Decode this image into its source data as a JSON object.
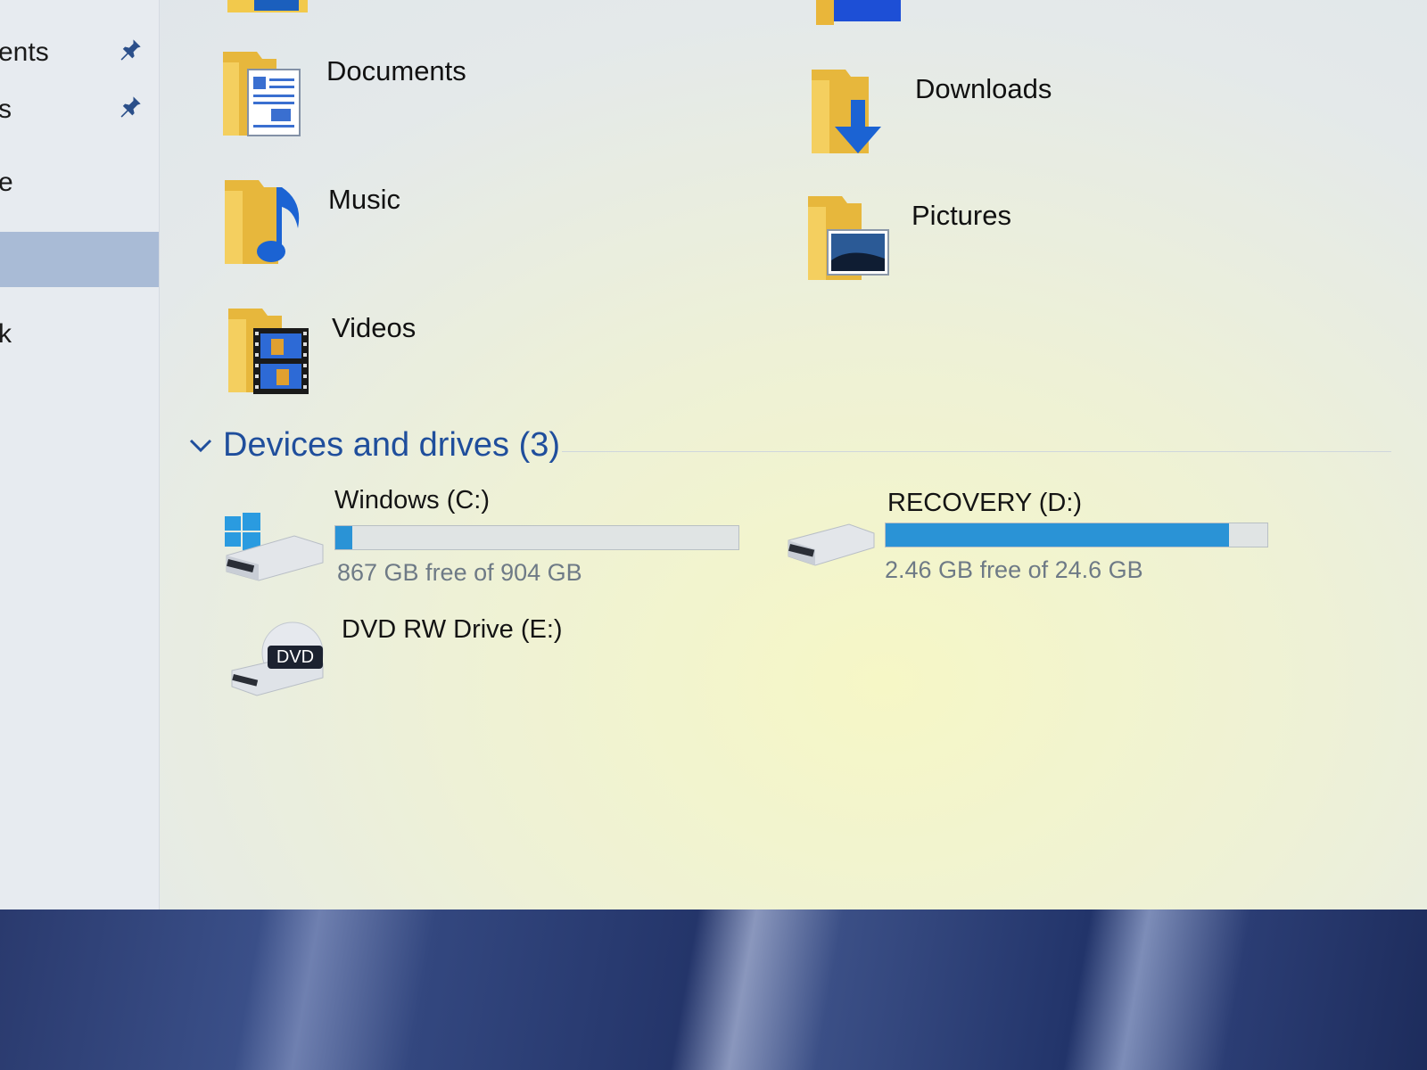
{
  "sidebar": {
    "items": [
      {
        "label": "ents",
        "pinned": true
      },
      {
        "label": "s",
        "pinned": true
      },
      {
        "label": "e",
        "pinned": false
      },
      {
        "label": "",
        "pinned": false,
        "selected": true
      },
      {
        "label": "k",
        "pinned": false
      }
    ]
  },
  "folders": [
    {
      "name": "Documents",
      "icon": "documents-folder-icon"
    },
    {
      "name": "Downloads",
      "icon": "downloads-folder-icon"
    },
    {
      "name": "Music",
      "icon": "music-folder-icon"
    },
    {
      "name": "Pictures",
      "icon": "pictures-folder-icon"
    },
    {
      "name": "Videos",
      "icon": "videos-folder-icon"
    }
  ],
  "devices": {
    "header": "Devices and drives (3)",
    "drives": [
      {
        "name": "Windows (C:)",
        "free_text": "867 GB free of 904 GB",
        "used_fraction": 0.041,
        "icon": "windows-drive-icon"
      },
      {
        "name": "RECOVERY (D:)",
        "free_text": "2.46 GB free of 24.6 GB",
        "used_fraction": 0.9,
        "icon": "hard-drive-icon"
      },
      {
        "name": "DVD RW Drive (E:)",
        "icon": "dvd-drive-icon",
        "badge": "DVD"
      }
    ]
  },
  "colors": {
    "accent": "#1f4e9c",
    "bar_fill": "#2a93d6",
    "folder_yellow": "#f2c94c"
  }
}
